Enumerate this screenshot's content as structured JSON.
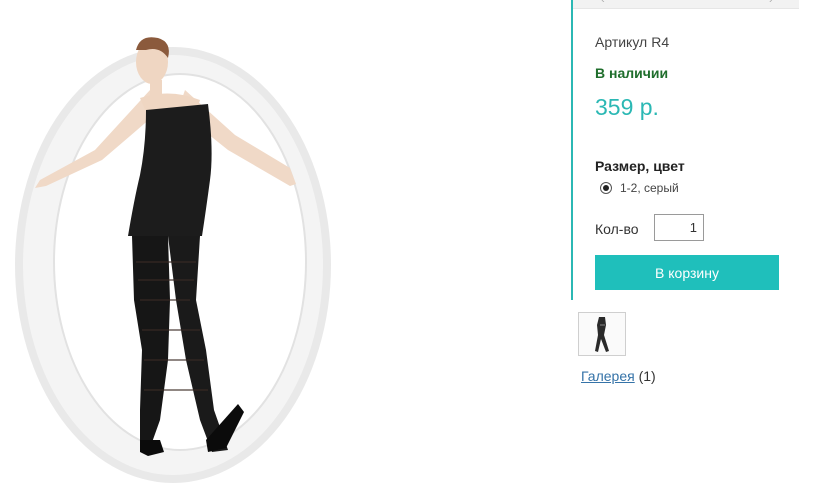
{
  "product": {
    "image_alt": "product-photo",
    "thumbnail_alt": "product-thumbnail"
  },
  "nav": {
    "prev_glyph": "‹",
    "next_glyph": "›"
  },
  "buy_panel": {
    "sku_label": "Артикул",
    "sku_value": "R4",
    "stock_status": "В наличии",
    "price": "359 р.",
    "variant_title": "Размер, цвет",
    "variant_selected": "1-2, серый",
    "qty_label": "Кол-во",
    "qty_value": "1",
    "add_to_cart_label": "В корзину"
  },
  "gallery": {
    "link_label": "Галерея",
    "count": "(1)"
  },
  "colors": {
    "accent": "#1fbfbb",
    "price": "#2bb8b4",
    "stock": "#1f6e2c",
    "link": "#3573a8"
  }
}
